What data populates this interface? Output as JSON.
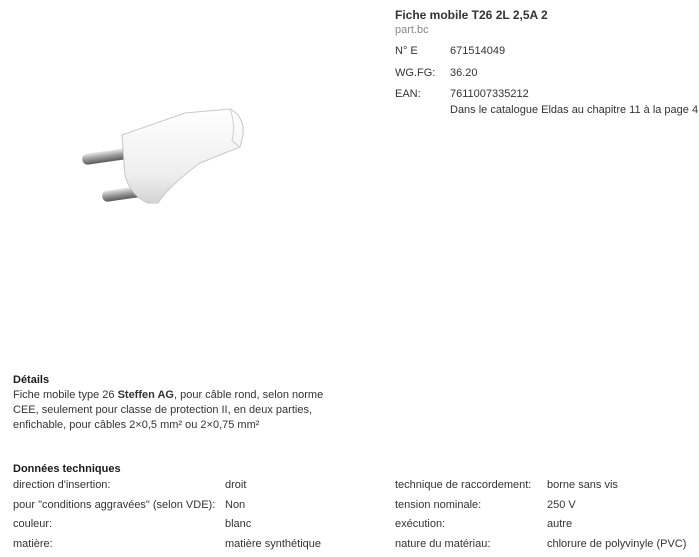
{
  "product": {
    "title": "Fiche mobile T26 2L 2,5A 2",
    "subtitle": "part.bc",
    "meta": [
      {
        "label": "N° E",
        "value": "671514049"
      },
      {
        "label": "WG.FG:",
        "value": "36.20"
      },
      {
        "label": "EAN:",
        "value": "7611007335212"
      }
    ],
    "catalogue": "Dans le catalogue Eldas au chapitre 11 à la page 4"
  },
  "details": {
    "heading": "Détails",
    "text_pre": "Fiche mobile type 26 ",
    "text_brand": "Steffen AG",
    "text_post": ", pour câble rond, selon norme CEE, seulement pour classe de protection II, en deux parties, enfichable, pour câbles 2×0,5 mm² ou 2×0,75 mm²"
  },
  "tech": {
    "heading": "Données techniques",
    "rows": [
      {
        "k1": "direction d'insertion:",
        "v1": "droit",
        "k2": "technique de raccordement:",
        "v2": "borne sans vis"
      },
      {
        "k1": "pour \"conditions aggravées\" (selon VDE):",
        "v1": "Non",
        "k2": "tension nominale:",
        "v2": "250 V"
      },
      {
        "k1": "couleur:",
        "v1": "blanc",
        "k2": "exécution:",
        "v2": "autre"
      },
      {
        "k1": "matière:",
        "v1": "matière synthétique",
        "k2": "nature du matériau:",
        "v2": "chlorure de polyvinyle (PVC)"
      }
    ]
  }
}
